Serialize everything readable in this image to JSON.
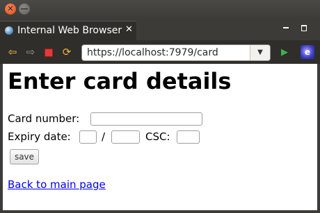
{
  "window": {
    "close_glyph": "✕",
    "min_glyph": "—"
  },
  "tab": {
    "title": "Internal Web Browser",
    "close_glyph": "✕"
  },
  "toolbar": {
    "back_glyph": "⇦",
    "forward_glyph": "⇨",
    "refresh_glyph": "⟳",
    "url": "https://localhost:7979/card",
    "dropdown_glyph": "▼",
    "go_glyph": "▶",
    "ext_glyph": "e"
  },
  "page": {
    "heading": "Enter card details",
    "card_number_label": "Card number:",
    "expiry_label": "Expiry date:",
    "expiry_separator": "/",
    "csc_label": "CSC:",
    "save_label": "save",
    "back_link": "Back to main page"
  },
  "colors": {
    "link": "#0000ee",
    "stop": "#e23a3a",
    "go": "#3fb34f"
  }
}
